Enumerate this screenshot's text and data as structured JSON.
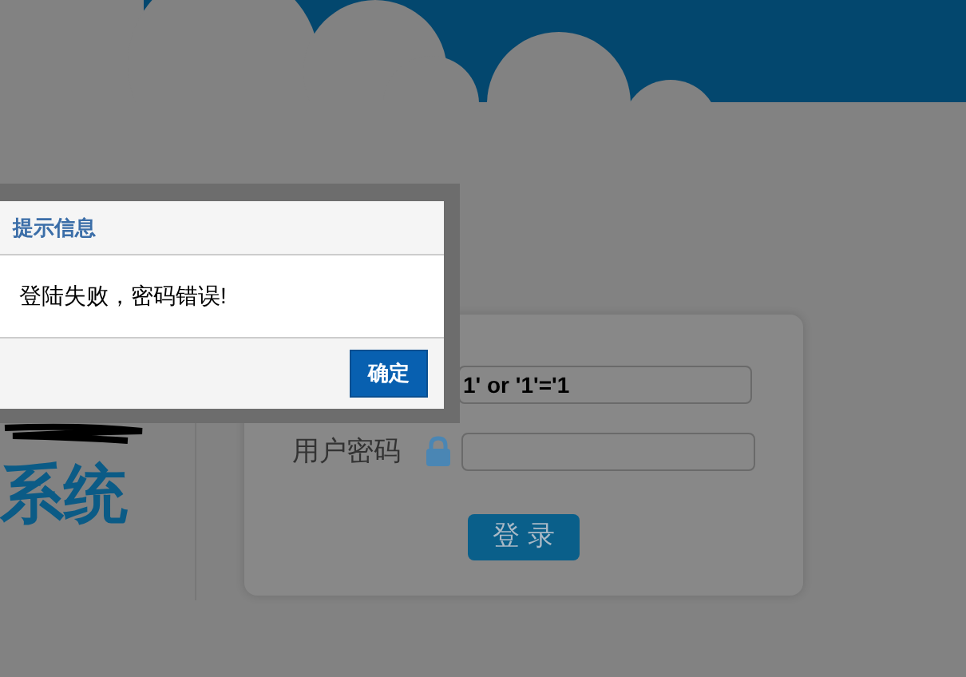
{
  "system_title": "系统",
  "login_form": {
    "username": {
      "value": "1' or '1'='1"
    },
    "password": {
      "label": "用户密码"
    },
    "login_button": "登 录"
  },
  "dialog": {
    "title": "提示信息",
    "message": "登陆失败，密码错误!",
    "ok_button": "确定"
  }
}
